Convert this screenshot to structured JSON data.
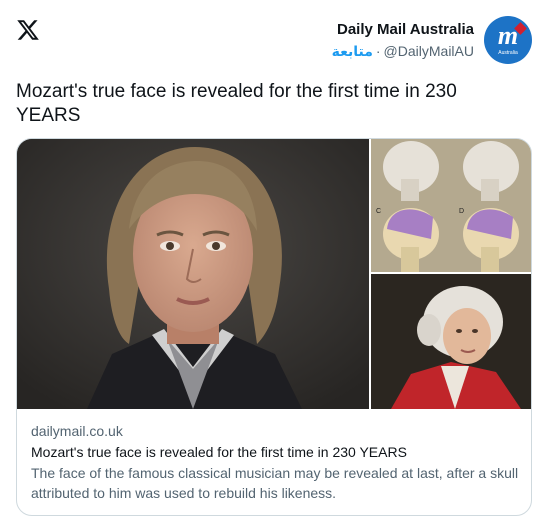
{
  "header": {
    "logo_icon": "x-logo-icon",
    "display_name": "Daily Mail Australia",
    "follow_label": "متابعة",
    "separator": "·",
    "handle": "@DailyMailAU",
    "avatar": {
      "letter": "m",
      "subtitle": "Australia",
      "bg_color": "#1d73c6",
      "star_color": "#d11f2f"
    }
  },
  "tweet": {
    "text": "Mozart's true face is revealed for the first time in 230 YEARS"
  },
  "card": {
    "domain": "dailymail.co.uk",
    "title": "Mozart's true face is revealed for the first time in 230 YEARS",
    "description": "The face of the famous classical musician may be revealed at last, after a skull attributed to him was used to rebuild his likeness.",
    "images": {
      "main": "reconstructed-face-image",
      "skull_panels": {
        "labels": [
          "C",
          "D"
        ]
      },
      "portrait": "mozart-portrait-image"
    }
  },
  "colors": {
    "accent": "#1d9bf0",
    "text": "#0f1419",
    "secondary": "#536471",
    "border": "#cfd9de"
  }
}
